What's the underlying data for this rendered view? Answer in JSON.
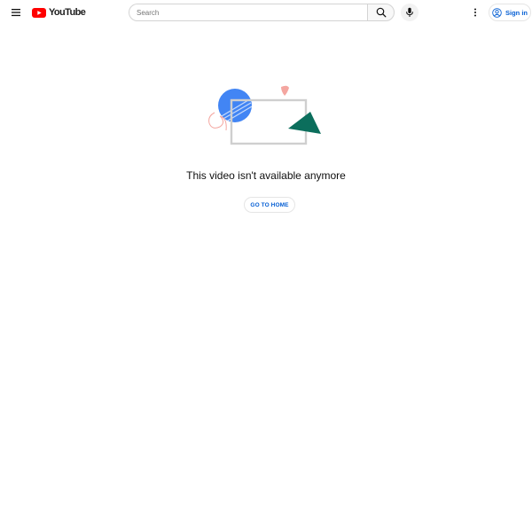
{
  "header": {
    "logo_text": "YouTube",
    "search": {
      "placeholder": "Search",
      "value": ""
    },
    "signin_label": "Sign in"
  },
  "icons": {
    "menu": "hamburger-menu-icon",
    "logo": "youtube-play-icon",
    "search": "search-icon",
    "mic": "microphone-icon",
    "more": "more-vertical-icon",
    "account": "account-circle-icon"
  },
  "main": {
    "message": "This video isn't available anymore",
    "home_button_label": "GO TO HOME"
  },
  "colors": {
    "brand_red": "#ff0000",
    "link_blue": "#065fd4",
    "illustration_blue": "#4285f4",
    "illustration_green": "#0b6e5c",
    "illustration_pink": "#f4a6a0",
    "illustration_frame": "#cfcfcf"
  }
}
